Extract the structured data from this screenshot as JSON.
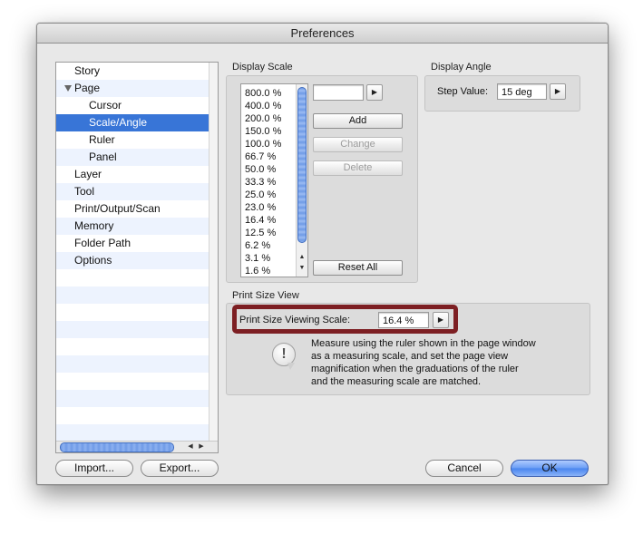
{
  "window": {
    "title": "Preferences"
  },
  "sidebar": {
    "items": [
      {
        "label": "Story"
      },
      {
        "label": "Page"
      },
      {
        "label": "Cursor"
      },
      {
        "label": "Scale/Angle"
      },
      {
        "label": "Ruler"
      },
      {
        "label": "Panel"
      },
      {
        "label": "Layer"
      },
      {
        "label": "Tool"
      },
      {
        "label": "Print/Output/Scan"
      },
      {
        "label": "Memory"
      },
      {
        "label": "Folder Path"
      },
      {
        "label": "Options"
      }
    ],
    "selected": "Scale/Angle"
  },
  "display_scale": {
    "title": "Display Scale",
    "values": [
      "800.0 %",
      "400.0 %",
      "200.0 %",
      "150.0 %",
      "100.0 %",
      "66.7 %",
      "50.0 %",
      "33.3 %",
      "25.0 %",
      "23.0 %",
      "16.4 %",
      "12.5 %",
      "6.2 %",
      "3.1 %",
      "1.6 %"
    ],
    "input_value": "",
    "add_label": "Add",
    "change_label": "Change",
    "delete_label": "Delete",
    "reset_label": "Reset All"
  },
  "display_angle": {
    "title": "Display Angle",
    "step_label": "Step Value:",
    "step_value": "15 deg"
  },
  "print_size": {
    "title": "Print Size View",
    "scale_label": "Print Size Viewing Scale:",
    "scale_value": "16.4 %",
    "description": [
      "Measure using the ruler shown in the page window",
      "as a measuring scale, and set the page view",
      "magnification when the graduations of the ruler",
      "and the measuring scale are matched."
    ]
  },
  "buttons": {
    "import": "Import...",
    "export": "Export...",
    "cancel": "Cancel",
    "ok": "OK"
  },
  "colors": {
    "selection": "#3875d7",
    "highlight_box": "#7d1f23",
    "default_button": "#4784ef"
  }
}
